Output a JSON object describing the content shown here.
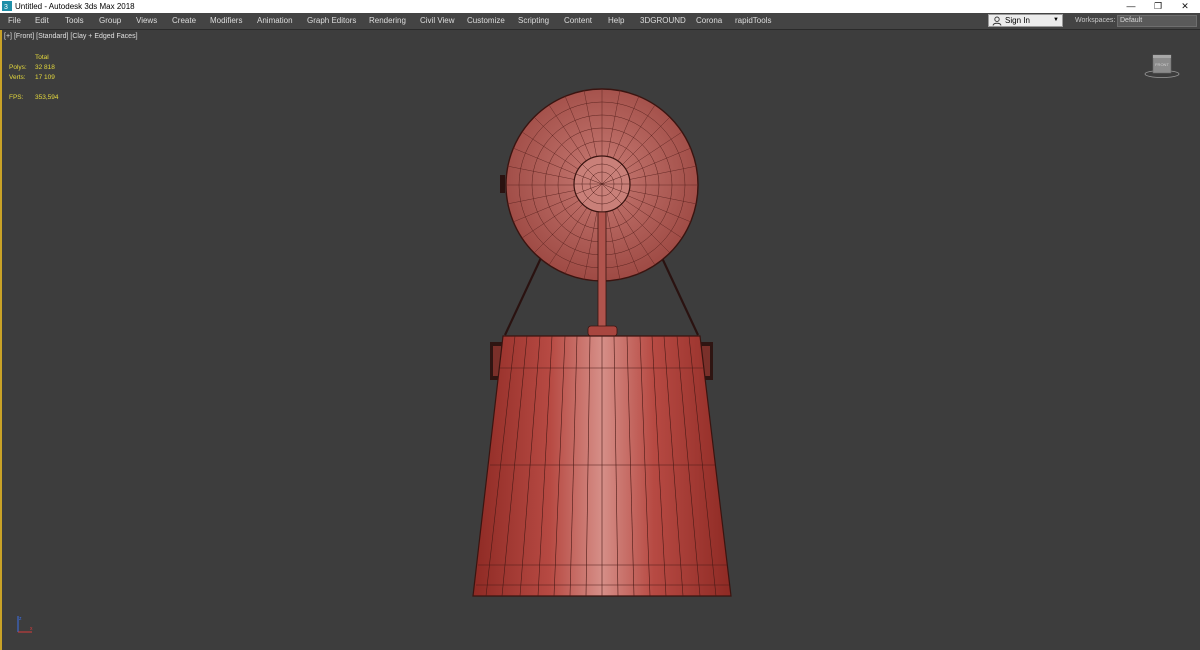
{
  "window": {
    "title": "Untitled - Autodesk 3ds Max 2018",
    "minimize": "—",
    "maximize": "❐",
    "close": "✕"
  },
  "menu": {
    "items": [
      "File",
      "Edit",
      "Tools",
      "Group",
      "Views",
      "Create",
      "Modifiers",
      "Animation",
      "Graph Editors",
      "Rendering",
      "Civil View",
      "Customize",
      "Scripting",
      "Content",
      "Help",
      "3DGROUND",
      "Corona",
      "rapidTools"
    ]
  },
  "account": {
    "sign_in": "Sign In"
  },
  "workspaces": {
    "label": "Workspaces:",
    "value": "Default"
  },
  "viewport": {
    "label_plus": "[+]",
    "label_view": "[Front]",
    "label_shading": "[Standard]",
    "label_mode": "[Clay + Edged Faces]",
    "stats": {
      "total_label": "Total",
      "polys_label": "Polys:",
      "polys_value": "32 818",
      "verts_label": "Verts:",
      "verts_value": "17 109",
      "fps_label": "FPS:",
      "fps_value": "353,594"
    },
    "model_color": "#b24a42",
    "wire_color": "#3a1410"
  },
  "icons": {
    "app": "3ds-max-app-icon",
    "user": "user-icon",
    "viewcube": "viewcube-icon",
    "axis": "axis-tripod-icon"
  }
}
